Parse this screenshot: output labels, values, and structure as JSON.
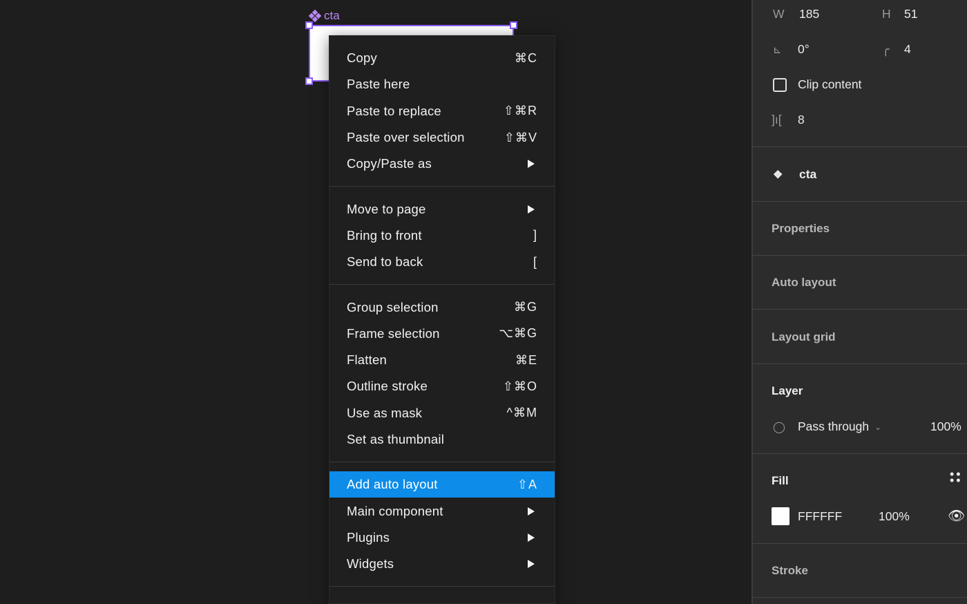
{
  "canvas": {
    "frame_label": "cta",
    "frame_icon": "component-icon",
    "selection_color": "#8b5cf6"
  },
  "context_menu": {
    "groups": [
      [
        {
          "label": "Copy",
          "shortcut": "⌘C"
        },
        {
          "label": "Paste here",
          "shortcut": ""
        },
        {
          "label": "Paste to replace",
          "shortcut": "⇧⌘R"
        },
        {
          "label": "Paste over selection",
          "shortcut": "⇧⌘V"
        },
        {
          "label": "Copy/Paste as",
          "submenu": true
        }
      ],
      [
        {
          "label": "Move to page",
          "submenu": true
        },
        {
          "label": "Bring to front",
          "shortcut": "]"
        },
        {
          "label": "Send to back",
          "shortcut": "["
        }
      ],
      [
        {
          "label": "Group selection",
          "shortcut": "⌘G"
        },
        {
          "label": "Frame selection",
          "shortcut": "⌥⌘G"
        },
        {
          "label": "Flatten",
          "shortcut": "⌘E"
        },
        {
          "label": "Outline stroke",
          "shortcut": "⇧⌘O"
        },
        {
          "label": "Use as mask",
          "shortcut": "^⌘M"
        },
        {
          "label": "Set as thumbnail",
          "shortcut": ""
        }
      ],
      [
        {
          "label": "Add auto layout",
          "shortcut": "⇧A",
          "active": true
        },
        {
          "label": "Main component",
          "submenu": true
        },
        {
          "label": "Plugins",
          "submenu": true
        },
        {
          "label": "Widgets",
          "submenu": true
        }
      ]
    ],
    "highlight_color": "#0d8ce9"
  },
  "panel": {
    "w_label": "W",
    "w_value": "185",
    "h_label": "H",
    "h_value": "51",
    "rotation_value": "0°",
    "radius_value": "4",
    "clip_content_label": "Clip content",
    "clip_content_checked": false,
    "spacing_value": "8",
    "component_name": "cta",
    "sections": {
      "properties": "Properties",
      "auto_layout": "Auto layout",
      "layout_grid": "Layout grid",
      "layer": "Layer",
      "fill": "Fill",
      "stroke": "Stroke"
    },
    "layer": {
      "blend_mode": "Pass through",
      "opacity": "100%"
    },
    "fill": {
      "hex": "FFFFFF",
      "opacity": "100%",
      "color": "#ffffff"
    }
  }
}
